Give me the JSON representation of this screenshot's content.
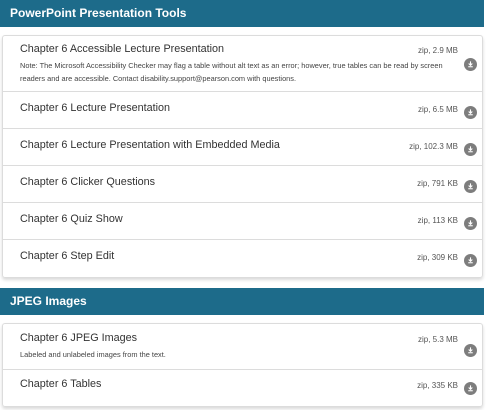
{
  "sections": [
    {
      "title": "PowerPoint Presentation Tools",
      "items": [
        {
          "title": "Chapter 6 Accessible Lecture Presentation",
          "size": "zip, 2.9 MB",
          "note": "Note: The Microsoft Accessibility Checker may flag a table without alt text as an error; however, true tables can be read by screen readers and are accessible. Contact disability.support@pearson.com with questions."
        },
        {
          "title": "Chapter 6 Lecture Presentation",
          "size": "zip, 6.5 MB"
        },
        {
          "title": "Chapter 6 Lecture Presentation with Embedded Media",
          "size": "zip, 102.3 MB"
        },
        {
          "title": "Chapter 6 Clicker Questions",
          "size": "zip, 791 KB"
        },
        {
          "title": "Chapter 6 Quiz Show",
          "size": "zip, 113 KB"
        },
        {
          "title": "Chapter 6 Step Edit",
          "size": "zip, 309 KB"
        }
      ]
    },
    {
      "title": "JPEG Images",
      "items": [
        {
          "title": "Chapter 6 JPEG Images",
          "size": "zip, 5.3 MB",
          "note": "Labeled and unlabeled images from the text."
        },
        {
          "title": "Chapter 6 Tables",
          "size": "zip, 335 KB"
        }
      ]
    }
  ],
  "icons": {
    "download": "download-icon"
  },
  "colors": {
    "header_bg": "#1d6b8a",
    "header_text": "#ffffff",
    "icon_bg": "#7d7d7d"
  }
}
